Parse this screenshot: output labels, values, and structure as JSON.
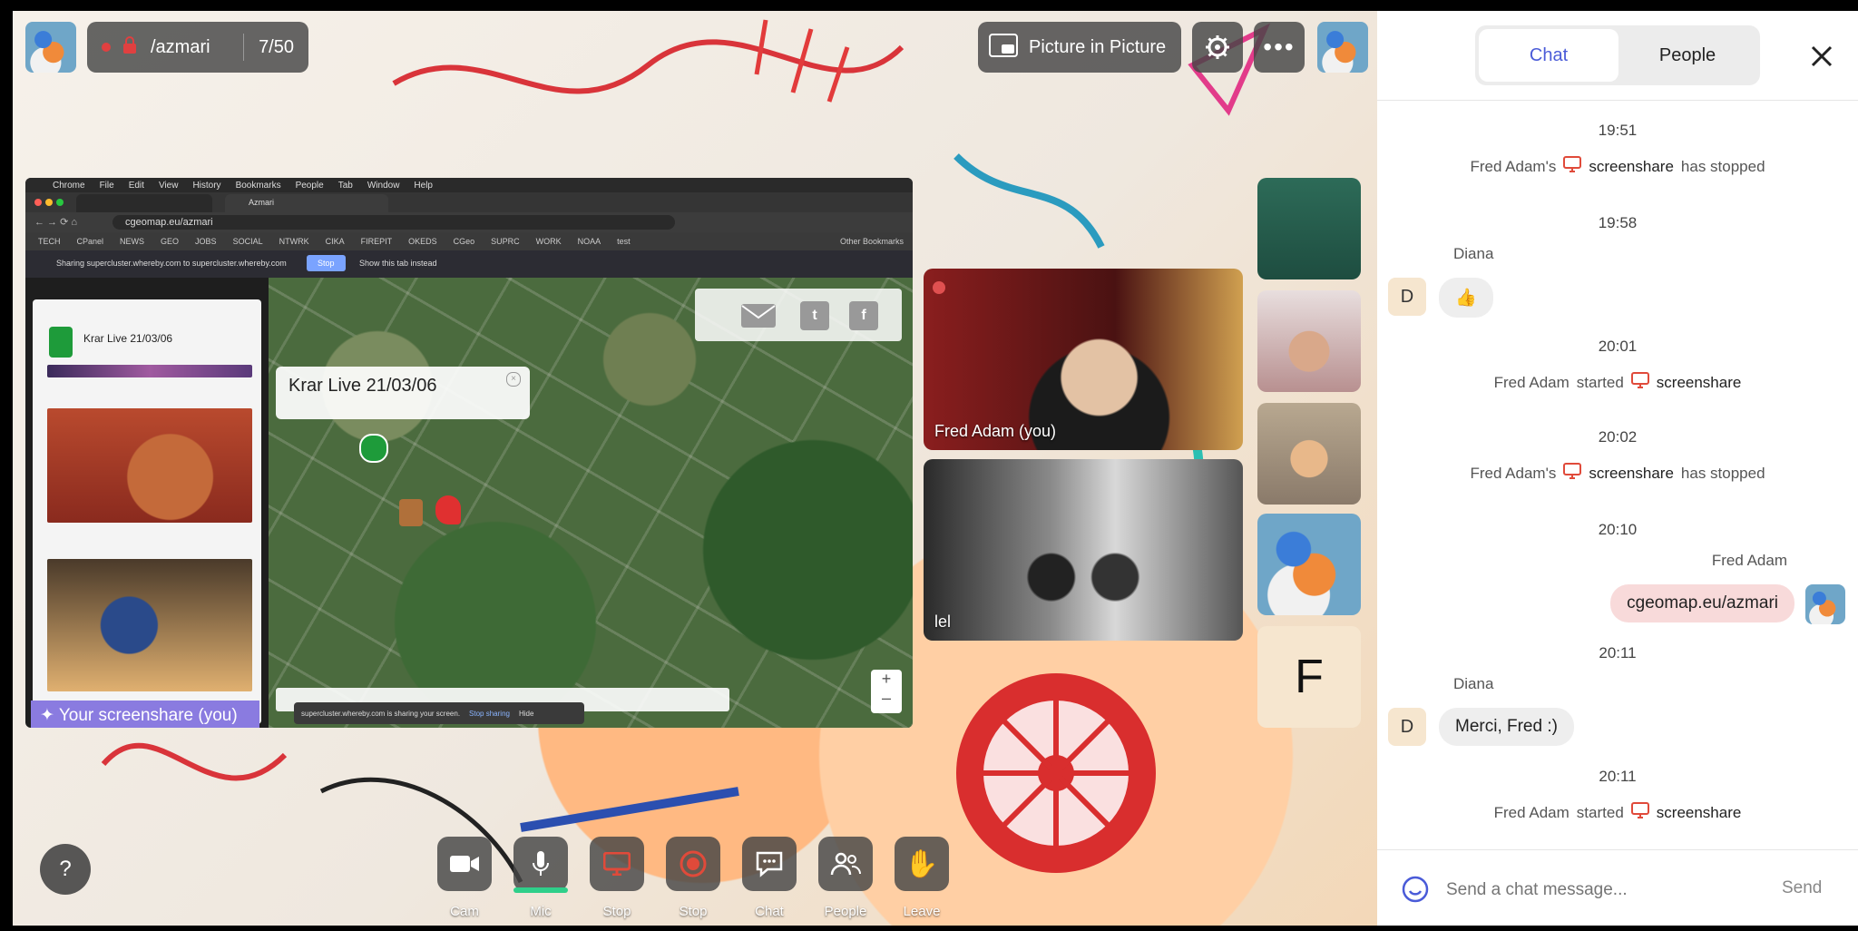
{
  "room": {
    "name": "/azmari",
    "count": "7/50",
    "pip_label": "Picture in Picture"
  },
  "share": {
    "menu": [
      "Chrome",
      "File",
      "Edit",
      "View",
      "History",
      "Bookmarks",
      "People",
      "Tab",
      "Window",
      "Help"
    ],
    "url": "cgeomap.eu/azmari",
    "tab_label": "Azmari",
    "sharing_text": "Sharing supercluster.whereby.com to supercluster.whereby.com",
    "stop_btn": "Stop",
    "show_tab_btn": "Show this tab instead",
    "bookmarks": [
      "TECH",
      "CPanel",
      "NEWS",
      "GEO",
      "JOBS",
      "SOCIAL",
      "NTWRK",
      "CIKA",
      "FIREPIT",
      "OKEDS",
      "CGeo",
      "SUPRC",
      "WORK",
      "NOAA",
      "test",
      "Other Bookmarks"
    ],
    "panel_title": "Krar Live 21/03/06",
    "popup_title": "Krar Live 21/03/06",
    "label": "Your screenshare (you)",
    "bottom_notice": "supercluster.whereby.com is sharing your screen.",
    "bottom_stop": "Stop sharing",
    "bottom_hide": "Hide"
  },
  "tiles": {
    "fred": "Fred Adam (you)",
    "lel": "lel",
    "f_initial": "F"
  },
  "toolbar": {
    "help": "?",
    "buttons": [
      "Cam",
      "Mic",
      "Stop",
      "Stop",
      "Chat",
      "People",
      "Leave"
    ]
  },
  "chat": {
    "tab_chat": "Chat",
    "tab_people": "People",
    "messages": {
      "t1": "19:51",
      "s1_name": "Fred Adam's",
      "s1_item": "screenshare",
      "s1_action": "has stopped",
      "t2": "19:58",
      "d1_name": "Diana",
      "d1_initial": "D",
      "d1_text": "👍",
      "t3": "20:01",
      "s2_name": "Fred Adam",
      "s2_action": "started",
      "s2_item": "screenshare",
      "t4": "20:02",
      "s3_name": "Fred Adam's",
      "s3_item": "screenshare",
      "s3_action": "has stopped",
      "t5": "20:10",
      "f1_name": "Fred Adam",
      "f1_text": "cgeomap.eu/azmari",
      "t6": "20:11",
      "d2_name": "Diana",
      "d2_initial": "D",
      "d2_text": "Merci, Fred :)",
      "t7": "20:11",
      "s4_name": "Fred Adam",
      "s4_action": "started",
      "s4_item": "screenshare"
    },
    "input_placeholder": "Send a chat message...",
    "send_label": "Send"
  }
}
